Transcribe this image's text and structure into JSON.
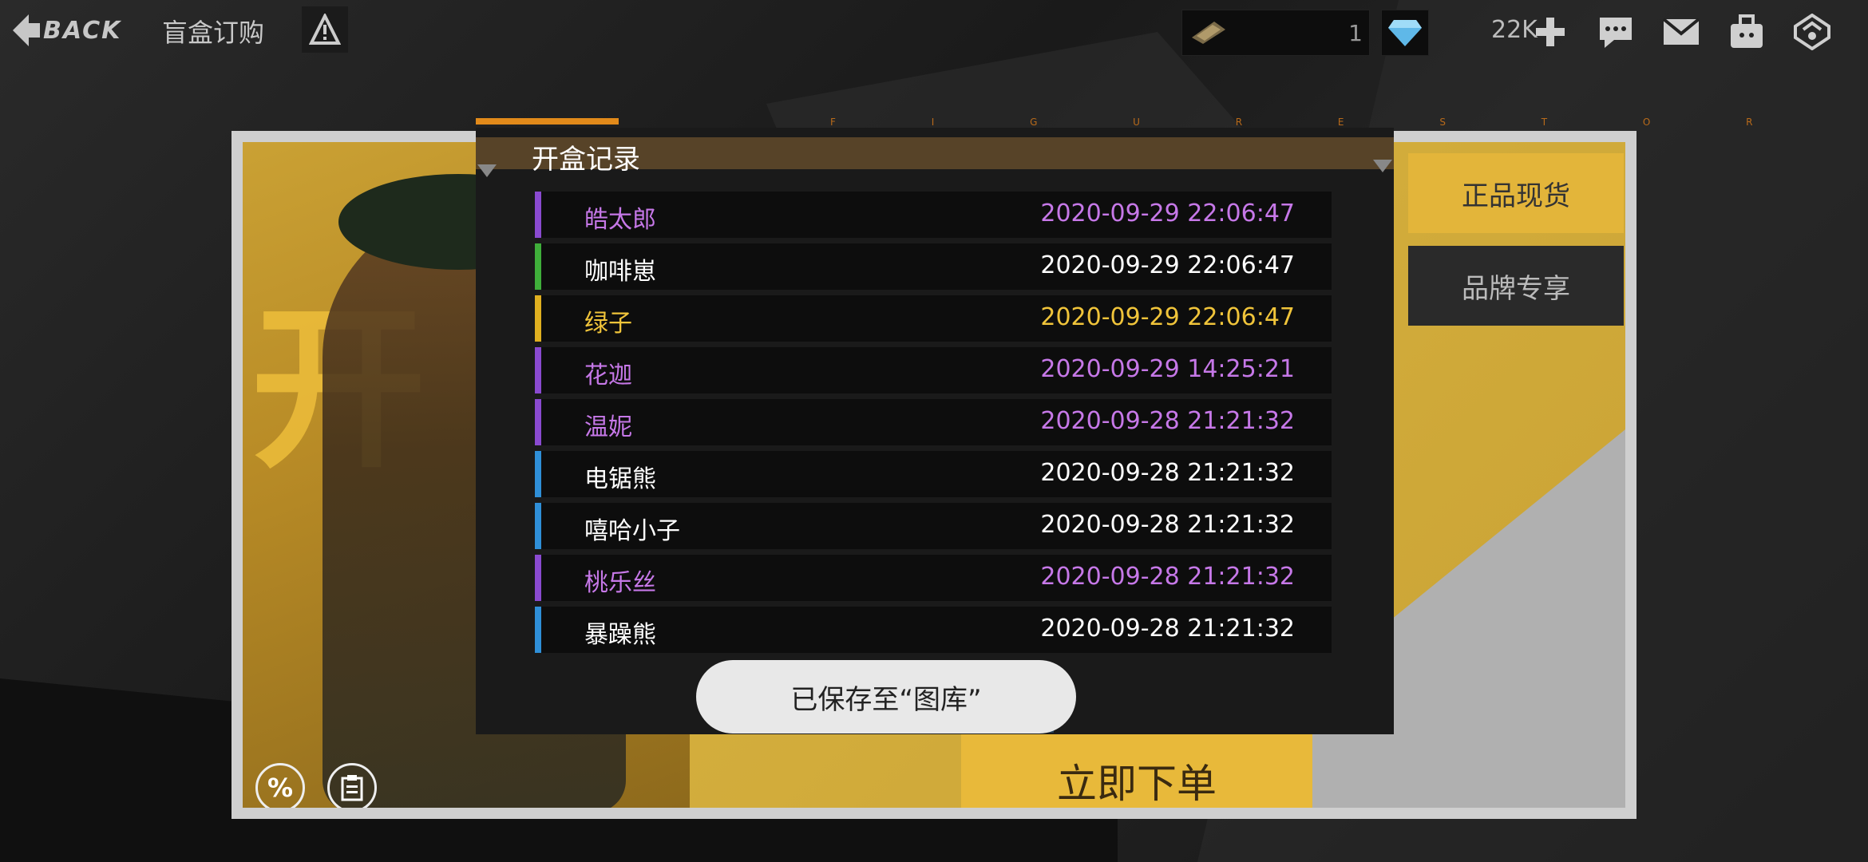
{
  "topbar": {
    "back_label": "BACK",
    "title": "盲盒订购",
    "ticket_count": "1",
    "gem_count": "22K"
  },
  "banner": {
    "tab_stock": "正品现货",
    "tab_brand": "品牌专享",
    "order_button": "立即下单",
    "discount_icon": "%"
  },
  "modal": {
    "title": "开盒记录",
    "subtitle": "F I G U R E S T O R Y",
    "records": [
      {
        "name": "皓太郎",
        "time": "2020-09-29 22:06:47",
        "color": "#c678e8",
        "bar": "#8a4ad0"
      },
      {
        "name": "咖啡崽",
        "time": "2020-09-29 22:06:47",
        "color": "#ffffff",
        "bar": "#3fae3a"
      },
      {
        "name": "绿子",
        "time": "2020-09-29 22:06:47",
        "color": "#f0c43a",
        "bar": "#e0b020"
      },
      {
        "name": "花迦",
        "time": "2020-09-29 14:25:21",
        "color": "#c678e8",
        "bar": "#8a4ad0"
      },
      {
        "name": "温妮",
        "time": "2020-09-28 21:21:32",
        "color": "#c678e8",
        "bar": "#8a4ad0"
      },
      {
        "name": "电锯熊",
        "time": "2020-09-28 21:21:32",
        "color": "#ffffff",
        "bar": "#2f8fd8"
      },
      {
        "name": "嘻哈小子",
        "time": "2020-09-28 21:21:32",
        "color": "#ffffff",
        "bar": "#2f8fd8"
      },
      {
        "name": "桃乐丝",
        "time": "2020-09-28 21:21:32",
        "color": "#c678e8",
        "bar": "#8a4ad0"
      },
      {
        "name": "暴躁熊",
        "time": "2020-09-28 21:21:32",
        "color": "#ffffff",
        "bar": "#2f8fd8"
      }
    ]
  },
  "toast": "已保存至“图库”",
  "icons": {
    "back": "back-arrow-icon",
    "warning": "warning-icon",
    "ticket": "ticket-icon",
    "gem": "diamond-icon",
    "add": "plus-icon",
    "chat": "chat-icon",
    "mail": "mail-icon",
    "bag": "bag-icon",
    "rank": "rank-icon",
    "discount": "percent-icon",
    "clipboard": "clipboard-icon"
  }
}
